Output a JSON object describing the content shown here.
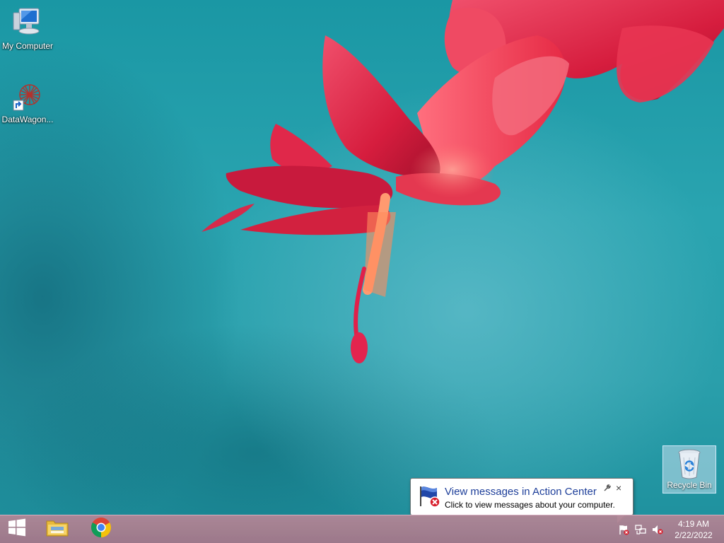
{
  "desktop": {
    "icons": [
      {
        "label": "My Computer",
        "icon": "computer-icon"
      },
      {
        "label": "DataWagon...",
        "icon": "datawagon-shortcut-icon"
      }
    ],
    "recycle_bin": {
      "label": "Recycle Bin",
      "icon": "recycle-bin-icon"
    }
  },
  "balloon": {
    "title": "View messages in Action Center",
    "text": "Click to view messages about your computer.",
    "icon": "action-center-flag-icon",
    "options_icon": "wrench-icon",
    "close_glyph": "×"
  },
  "taskbar": {
    "start": {
      "icon": "windows-logo-icon"
    },
    "pinned": [
      {
        "name": "File Explorer",
        "icon": "folder-icon"
      },
      {
        "name": "Google Chrome",
        "icon": "chrome-icon"
      }
    ],
    "tray": {
      "icons": [
        "action-center-flag-icon",
        "network-icon",
        "volume-muted-icon"
      ]
    },
    "clock": {
      "time": "4:19 AM",
      "date": "2/22/2022"
    }
  },
  "colors": {
    "wallpaper_teal": "#2aa4b0",
    "flower_red": "#e3324a",
    "taskbar": "#a87c90",
    "balloon_title": "#1e3f9a"
  }
}
